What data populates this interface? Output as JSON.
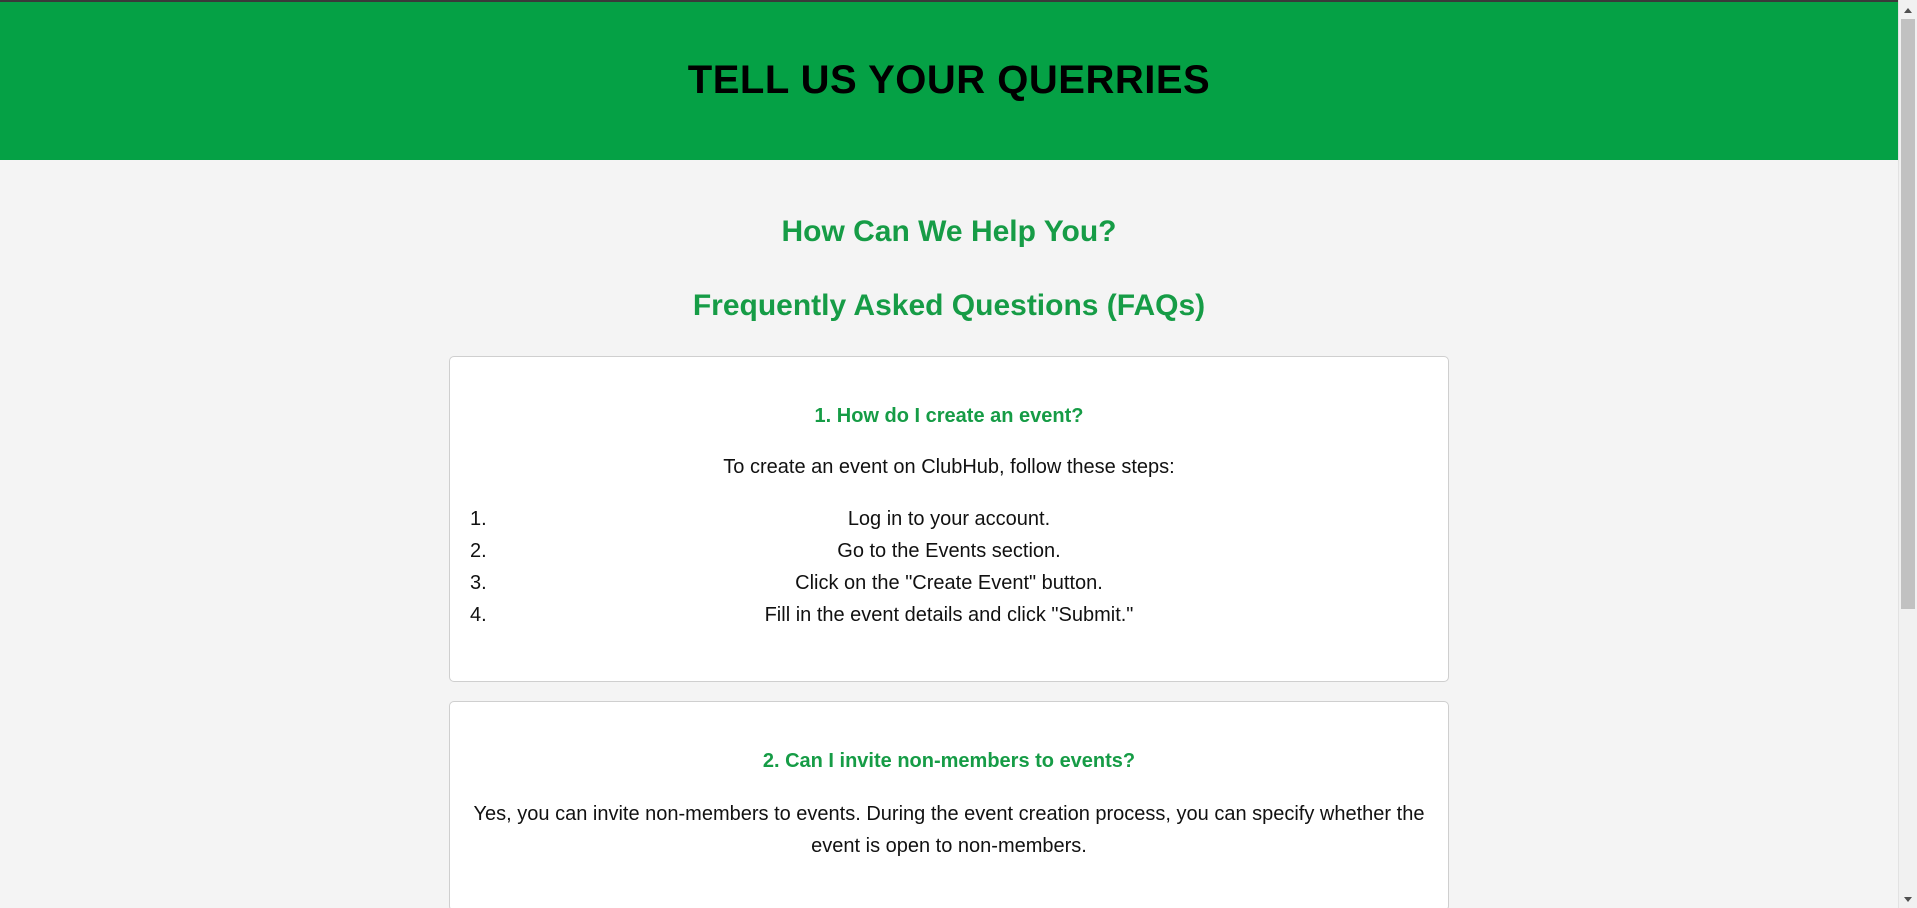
{
  "header": {
    "title": "TELL US YOUR QUERRIES",
    "background_color": "#05a145"
  },
  "help_title": "How Can We Help You?",
  "faq_title": "Frequently Asked Questions (FAQs)",
  "accent_color": "#169c46",
  "faqs": [
    {
      "question": "1. How do I create an event?",
      "answer": "To create an event on ClubHub, follow these steps:",
      "steps": [
        {
          "num": "1.",
          "text": "Log in to your account."
        },
        {
          "num": "2.",
          "text": "Go to the Events section."
        },
        {
          "num": "3.",
          "text": "Click on the \"Create Event\" button."
        },
        {
          "num": "4.",
          "text": "Fill in the event details and click \"Submit.\""
        }
      ]
    },
    {
      "question": "2. Can I invite non-members to events?",
      "answer": "Yes, you can invite non-members to events. During the event creation process, you can specify whether the event is open to non-members."
    }
  ],
  "scrollbar": {
    "up_icon": "chevron-up-icon",
    "down_icon": "chevron-down-icon"
  }
}
